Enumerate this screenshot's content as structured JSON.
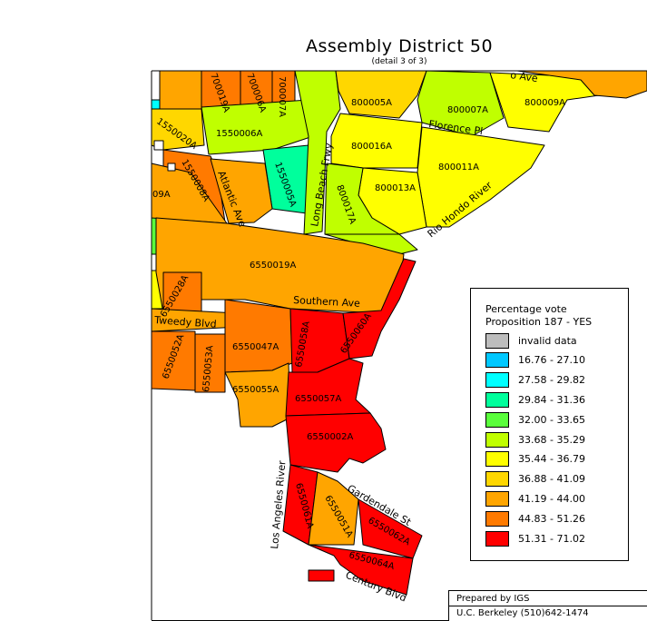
{
  "title": "Assembly District 50",
  "subtitle": "(detail 3 of 3)",
  "legend": {
    "title_line1": "Percentage vote",
    "title_line2": "Proposition 187 - YES",
    "items": [
      {
        "label": "invalid data",
        "color": "#bdbdbd"
      },
      {
        "label": "16.76 - 27.10",
        "color": "#00c8ff"
      },
      {
        "label": "27.58 - 29.82",
        "color": "#00ffff"
      },
      {
        "label": "29.84 - 31.36",
        "color": "#00ff9c"
      },
      {
        "label": "32.00 - 33.65",
        "color": "#5aff3c"
      },
      {
        "label": "33.68 - 35.29",
        "color": "#c0ff00"
      },
      {
        "label": "35.44 - 36.79",
        "color": "#ffff00"
      },
      {
        "label": "36.88 - 41.09",
        "color": "#ffd700"
      },
      {
        "label": "41.19 - 44.00",
        "color": "#ffa500"
      },
      {
        "label": "44.83 - 51.26",
        "color": "#ff7a00"
      },
      {
        "label": "51.31 - 71.02",
        "color": "#ff0000"
      }
    ]
  },
  "credit": {
    "line1": "Prepared by IGS",
    "line2": "U.C. Berkeley (510)642-1474"
  },
  "tracts": [
    "1550020A",
    "1550006A",
    "1550008A",
    "1550005A",
    "700019A",
    "700006A",
    "700007A",
    "800005A",
    "800007A",
    "800009A",
    "800016A",
    "800011A",
    "800013A",
    "800017A",
    "6550019A",
    "6550028A",
    "6550052A",
    "6550053A",
    "6550047A",
    "6550055A",
    "6550058A",
    "6550060A",
    "6550057A",
    "6550002A",
    "6550061A",
    "6550051A",
    "6550062A",
    "6550064A",
    "09A"
  ],
  "streets": [
    "Florence Pl",
    "Long Beach Frwy",
    "Atlantic Ave",
    "Rio Hondo River",
    "Southern Ave",
    "Tweedy Blvd",
    "Los Angeles River",
    "Gardendale St",
    "Century Blvd",
    "o Ave"
  ]
}
